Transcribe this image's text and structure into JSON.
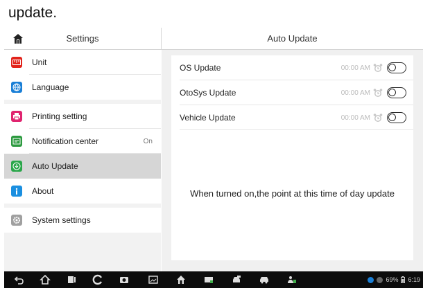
{
  "doc": {
    "heading": "update."
  },
  "left_header": {
    "title": "Settings",
    "home_icon": "home-icon"
  },
  "right_header": {
    "title": "Auto Update"
  },
  "sidebar": {
    "groups": [
      [
        {
          "label": "Unit",
          "icon": "unit-icon",
          "color": "#e2231a"
        },
        {
          "label": "Language",
          "icon": "globe-icon",
          "color": "#1a7fd6"
        }
      ],
      [
        {
          "label": "Printing setting",
          "icon": "printer-icon",
          "color": "#e0246f"
        },
        {
          "label": "Notification center",
          "icon": "notification-icon",
          "color": "#2c9a3f",
          "value": "On"
        },
        {
          "label": "Auto Update",
          "icon": "update-icon",
          "color": "#2aa64a",
          "active": true
        },
        {
          "label": "About",
          "icon": "info-icon",
          "color": "#1a8fe0"
        }
      ],
      [
        {
          "label": "System settings",
          "icon": "gear-icon",
          "color": "#a0a0a0"
        }
      ]
    ]
  },
  "updates": [
    {
      "label": "OS Update",
      "time": "00:00 AM",
      "enabled": false
    },
    {
      "label": "OtoSys Update",
      "time": "00:00 AM",
      "enabled": false
    },
    {
      "label": "Vehicle Update",
      "time": "00:00 AM",
      "enabled": false
    }
  ],
  "hint": "When turned on,the point at this time of day update",
  "navbar": {
    "buttons": [
      "back-icon",
      "home-icon",
      "recent-apps-icon",
      "browser-icon",
      "camera-icon",
      "image-icon",
      "home-alt-icon",
      "vci-icon",
      "car-icon",
      "car-alt-icon",
      "people-icon"
    ],
    "battery": "69%",
    "clock": "6:19"
  }
}
